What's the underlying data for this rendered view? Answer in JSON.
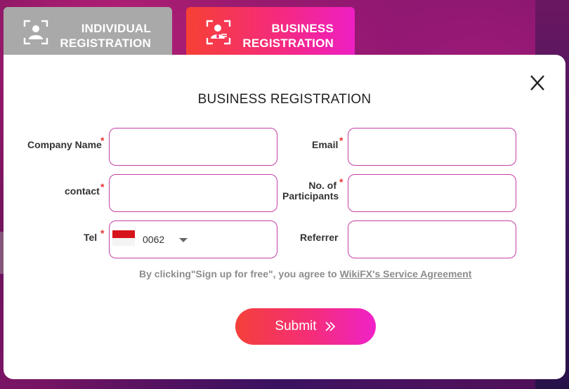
{
  "tabs": {
    "individual": {
      "line1": "INDIVIDUAL",
      "line2": "REGISTRATION",
      "icon": "person-frame-icon",
      "color": "#a9a9a9"
    },
    "business": {
      "line1": "BUSINESS",
      "line2": "REGISTRATION",
      "icon": "business-person-frame-icon",
      "gradient": [
        "#f64034",
        "#ee1fc4"
      ]
    }
  },
  "form": {
    "title": "BUSINESS REGISTRATION",
    "required_mark": "*",
    "fields": {
      "company_name": {
        "label": "Company Name",
        "value": "",
        "required": true
      },
      "email": {
        "label": "Email",
        "value": "",
        "required": true
      },
      "contact": {
        "label": "contact",
        "value": "",
        "required": true
      },
      "participants": {
        "label_line1": "No. of",
        "label_line2": "Participants",
        "value": "",
        "required": true
      },
      "tel": {
        "label": "Tel",
        "country_code": "0062",
        "flag": "indonesia-flag-icon",
        "required": true
      },
      "referrer": {
        "label": "Referrer",
        "value": "",
        "required": false
      }
    },
    "agreement": {
      "text": "By clicking\"Sign up for free\", you agree to ",
      "link": "WikiFX's Service Agreement"
    },
    "submit_label": "Submit"
  },
  "colors": {
    "accent_start": "#f4403a",
    "accent_end": "#ef22c8",
    "field_border": "#c53fa6",
    "required": "#e8362f"
  }
}
